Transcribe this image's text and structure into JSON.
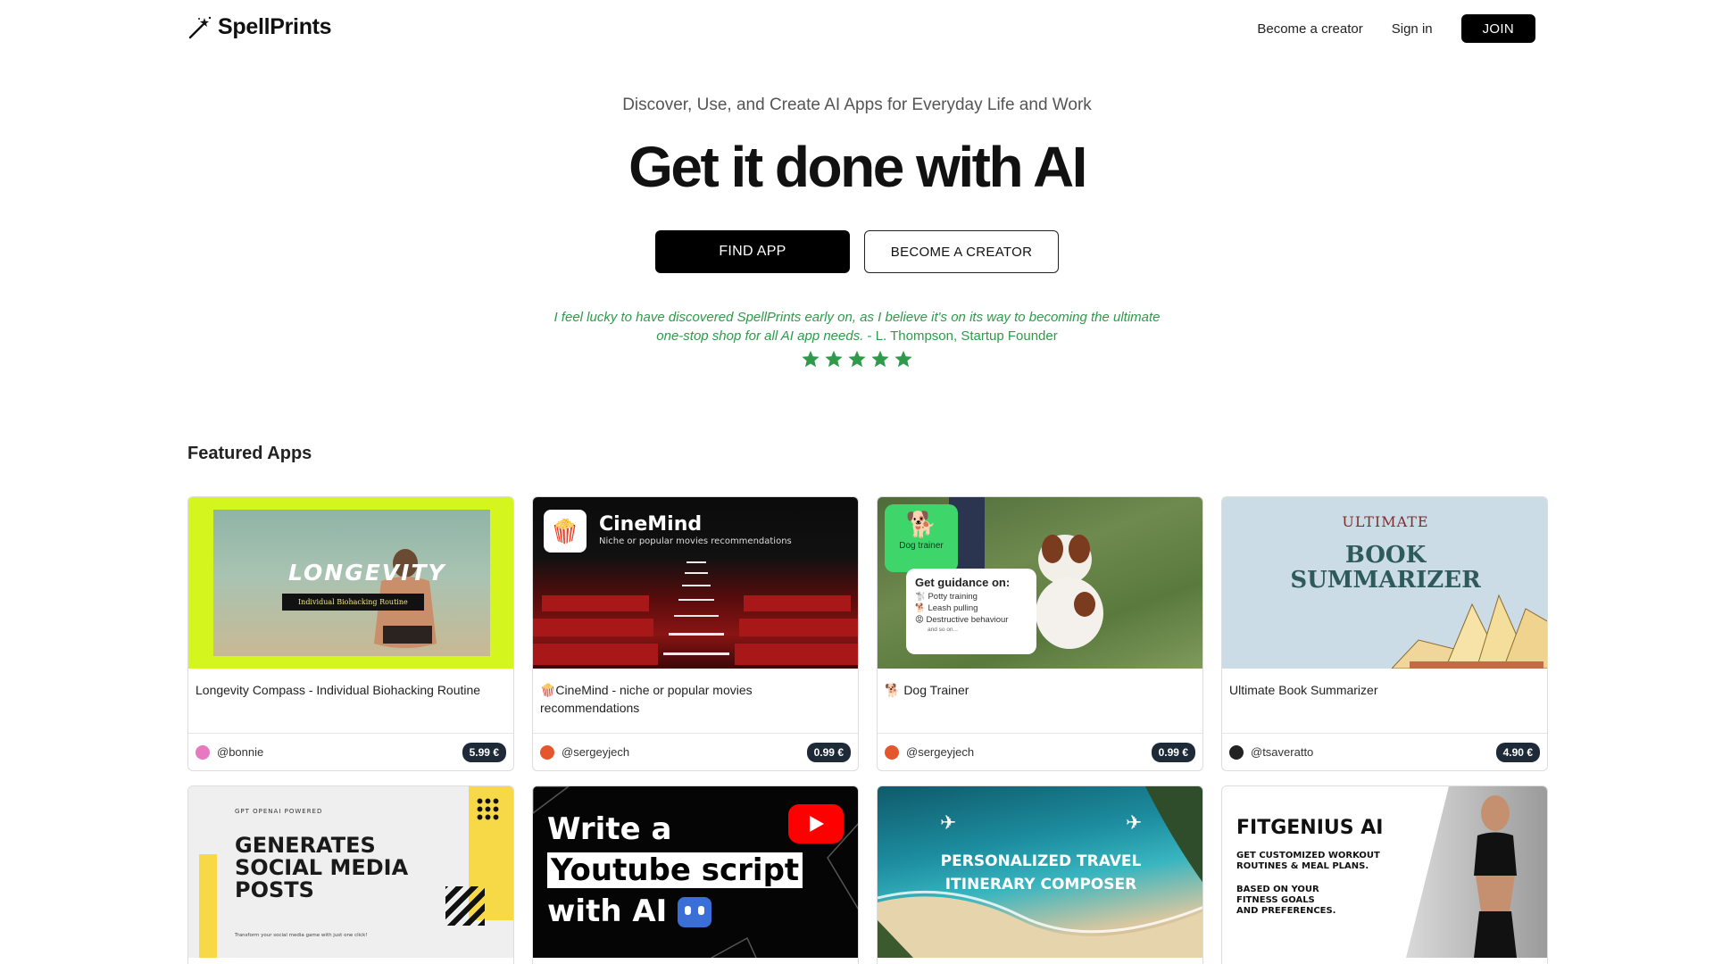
{
  "header": {
    "logo_text": "SpellPrints",
    "nav": {
      "become_creator": "Become a creator",
      "sign_in": "Sign in",
      "join": "JOIN"
    }
  },
  "hero": {
    "tagline": "Discover, Use, and Create AI Apps for Everyday Life and Work",
    "title": "Get it done with AI",
    "find_app": "FIND APP",
    "become_creator": "BECOME A CREATOR",
    "quote": "I feel lucky to have discovered SpellPrints early on, as I believe it's on its way to becoming the ultimate one-stop shop for all AI app needs.",
    "attribution": "- L. Thompson, Startup Founder",
    "rating": 5,
    "colors": {
      "accent_green": "#2e9a4a"
    }
  },
  "featured": {
    "title": "Featured Apps",
    "apps": [
      {
        "title": "Longevity Compass - Individual Biohacking Routine",
        "author": "@bonnie",
        "price": "5.99 €",
        "avatar_color": "#e779c1",
        "thumb": {
          "big": "LONGEVITY",
          "small": "Individual Biohacking Routine"
        }
      },
      {
        "title": "🍿CineMind - niche or popular movies recommendations",
        "author": "@sergeyjech",
        "price": "0.99 €",
        "avatar_color": "#e4572e",
        "thumb": {
          "name": "CineMind",
          "subtitle": "Niche or popular movies recommendations"
        }
      },
      {
        "title": "🐕 Dog Trainer",
        "author": "@sergeyjech",
        "price": "0.99 €",
        "avatar_color": "#e4572e",
        "thumb": {
          "badge": "Dog trainer",
          "heading": "Get guidance on:",
          "items": [
            "🐩 Potty training",
            "🐕 Leash pulling",
            "😡 Destructive behaviour"
          ],
          "more": "and so on..."
        }
      },
      {
        "title": "Ultimate Book Summarizer",
        "author": "@tsaveratto",
        "price": "4.90 €",
        "avatar_color": "#222222",
        "thumb": {
          "top": "ULTIMATE",
          "line1": "BOOK",
          "line2": "SUMMARIZER"
        }
      }
    ],
    "apps_row2": [
      {
        "thumb": {
          "kicker": "GPT OPENAI POWERED",
          "line1": "GENERATES",
          "line2": "SOCIAL MEDIA",
          "line3": "POSTS",
          "footnote": "Transform your social media game with just one click!"
        }
      },
      {
        "thumb": {
          "line1": "Write a",
          "line2": "Youtube script",
          "line3": "with AI"
        }
      },
      {
        "thumb": {
          "line1": "PERSONALIZED TRAVEL",
          "line2": "ITINERARY COMPOSER"
        }
      },
      {
        "thumb": {
          "name": "FITGENIUS AI",
          "line1": "GET CUSTOMIZED WORKOUT",
          "line2": "ROUTINES & MEAL PLANS.",
          "line3": "BASED ON YOUR",
          "line4": "FITNESS GOALS",
          "line5": "AND PREFERENCES."
        }
      }
    ]
  }
}
